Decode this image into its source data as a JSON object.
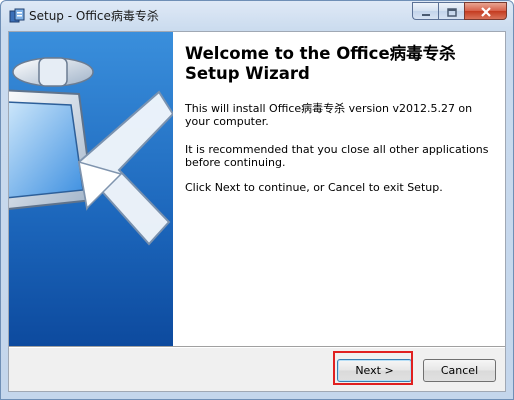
{
  "window": {
    "title": "Setup - Office病毒专杀",
    "caption_buttons": [
      "minimize",
      "maximize",
      "close"
    ]
  },
  "wizard": {
    "heading_line1": "Welcome to the Office病毒专杀",
    "heading_line2": "Setup Wizard",
    "paragraph1": "This will install Office病毒专杀 version v2012.5.27 on your computer.",
    "paragraph2": "It is recommended that you close all other applications before continuing.",
    "paragraph3": "Click Next to continue, or Cancel to exit Setup."
  },
  "buttons": {
    "next_label": "Next >",
    "cancel_label": "Cancel"
  },
  "colors": {
    "sidebar_blue": "#1a63b8",
    "highlight_red": "#e02020",
    "close_button": "#c43b20"
  },
  "icons": {
    "app": "installer-app-icon",
    "sidebar": "monitor-arrow-illustration"
  }
}
